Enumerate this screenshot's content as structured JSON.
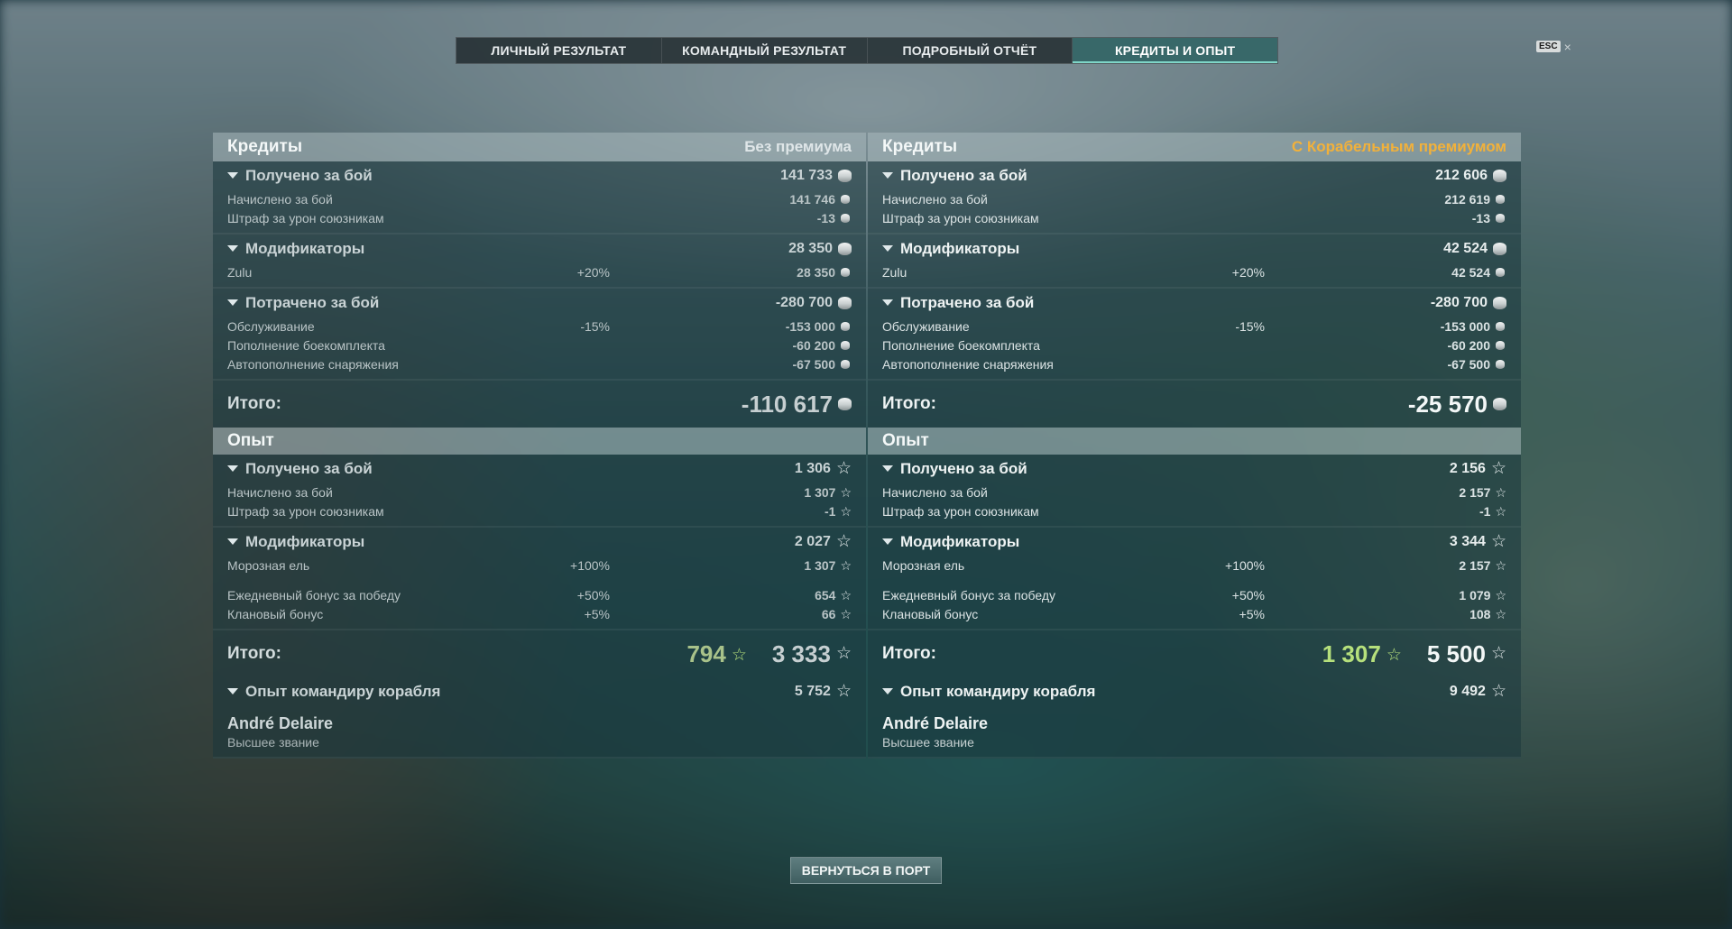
{
  "tabs": [
    {
      "label": "ЛИЧНЫЙ РЕЗУЛЬТАТ",
      "active": false
    },
    {
      "label": "КОМАНДНЫЙ РЕЗУЛЬТАТ",
      "active": false
    },
    {
      "label": "ПОДРОБНЫЙ ОТЧЁТ",
      "active": false
    },
    {
      "label": "КРЕДИТЫ И ОПЫТ",
      "active": true
    }
  ],
  "esc_label": "ESC",
  "close_glyph": "×",
  "colors": {
    "premium_accent": "#f2b13a",
    "xp_bonus_green": "#b6e07c"
  },
  "left": {
    "credits_title": "Кредиты",
    "credits_subtitle": "Без премиума",
    "earned": {
      "label": "Получено за бой",
      "value": "141 733",
      "rows": [
        {
          "label": "Начислено за бой",
          "pct": "",
          "value": "141 746"
        },
        {
          "label": "Штраф за урон союзникам",
          "pct": "",
          "value": "-13"
        }
      ]
    },
    "modifiers": {
      "label": "Модификаторы",
      "value": "28 350",
      "rows": [
        {
          "label": "Zulu",
          "pct": "+20%",
          "value": "28 350"
        }
      ]
    },
    "spent": {
      "label": "Потрачено за бой",
      "value": "-280 700",
      "rows": [
        {
          "label": "Обслуживание",
          "pct": "-15%",
          "value": "-153 000"
        },
        {
          "label": "Пополнение боекомплекта",
          "pct": "",
          "value": "-60 200"
        },
        {
          "label": "Автопополнение снаряжения",
          "pct": "",
          "value": "-67 500"
        }
      ]
    },
    "credits_total_label": "Итого:",
    "credits_total": "-110 617",
    "xp_title": "Опыт",
    "xp_earned": {
      "label": "Получено за бой",
      "value": "1 306",
      "rows": [
        {
          "label": "Начислено за бой",
          "pct": "",
          "value": "1 307"
        },
        {
          "label": "Штраф за урон союзникам",
          "pct": "",
          "value": "-1"
        }
      ]
    },
    "xp_modifiers": {
      "label": "Модификаторы",
      "value": "2 027",
      "rows": [
        {
          "label": "Морозная ель",
          "pct": "+100%",
          "value": "1 307"
        },
        {
          "label": "Ежедневный бонус за победу",
          "pct": "+50%",
          "value": "654"
        },
        {
          "label": "Клановый бонус",
          "pct": "+5%",
          "value": "66"
        }
      ]
    },
    "xp_total_label": "Итого:",
    "xp_total_free": "794",
    "xp_total": "3 333",
    "commander_label": "Опыт командиру корабля",
    "commander_value": "5 752",
    "commander_name": "André Delaire",
    "commander_rank": "Высшее звание"
  },
  "right": {
    "credits_title": "Кредиты",
    "credits_subtitle": "С Корабельным премиумом",
    "earned": {
      "label": "Получено за бой",
      "value": "212 606",
      "rows": [
        {
          "label": "Начислено за бой",
          "pct": "",
          "value": "212 619"
        },
        {
          "label": "Штраф за урон союзникам",
          "pct": "",
          "value": "-13"
        }
      ]
    },
    "modifiers": {
      "label": "Модификаторы",
      "value": "42 524",
      "rows": [
        {
          "label": "Zulu",
          "pct": "+20%",
          "value": "42 524"
        }
      ]
    },
    "spent": {
      "label": "Потрачено за бой",
      "value": "-280 700",
      "rows": [
        {
          "label": "Обслуживание",
          "pct": "-15%",
          "value": "-153 000"
        },
        {
          "label": "Пополнение боекомплекта",
          "pct": "",
          "value": "-60 200"
        },
        {
          "label": "Автопополнение снаряжения",
          "pct": "",
          "value": "-67 500"
        }
      ]
    },
    "credits_total_label": "Итого:",
    "credits_total": "-25 570",
    "xp_title": "Опыт",
    "xp_earned": {
      "label": "Получено за бой",
      "value": "2 156",
      "rows": [
        {
          "label": "Начислено за бой",
          "pct": "",
          "value": "2 157"
        },
        {
          "label": "Штраф за урон союзникам",
          "pct": "",
          "value": "-1"
        }
      ]
    },
    "xp_modifiers": {
      "label": "Модификаторы",
      "value": "3 344",
      "rows": [
        {
          "label": "Морозная ель",
          "pct": "+100%",
          "value": "2 157"
        },
        {
          "label": "Ежедневный бонус за победу",
          "pct": "+50%",
          "value": "1 079"
        },
        {
          "label": "Клановый бонус",
          "pct": "+5%",
          "value": "108"
        }
      ]
    },
    "xp_total_label": "Итого:",
    "xp_total_free": "1 307",
    "xp_total": "5 500",
    "commander_label": "Опыт командиру корабля",
    "commander_value": "9 492",
    "commander_name": "André Delaire",
    "commander_rank": "Высшее звание"
  },
  "back_button_label": "ВЕРНУТЬСЯ В ПОРТ",
  "icons": {
    "credits": "credits-coin-icon",
    "xp": "xp-star-icon",
    "expand": "triangle-down-icon"
  }
}
